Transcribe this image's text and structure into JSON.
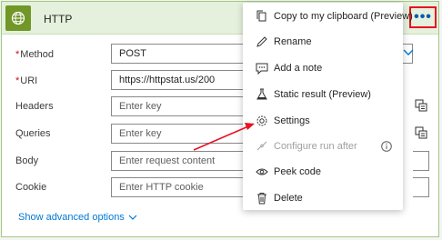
{
  "action": {
    "title": "HTTP"
  },
  "fields": [
    {
      "label": "Method",
      "required": true,
      "value": "POST",
      "placeholder": ""
    },
    {
      "label": "URI",
      "required": true,
      "value": "https://httpstat.us/200",
      "placeholder": ""
    },
    {
      "label": "Headers",
      "required": false,
      "value": "",
      "placeholder": "Enter key"
    },
    {
      "label": "Queries",
      "required": false,
      "value": "",
      "placeholder": "Enter key"
    },
    {
      "label": "Body",
      "required": false,
      "value": "",
      "placeholder": "Enter request content"
    },
    {
      "label": "Cookie",
      "required": false,
      "value": "",
      "placeholder": "Enter HTTP cookie"
    }
  ],
  "required_marker": "*",
  "advanced_options": "Show advanced options",
  "more_button": "•••",
  "menu": {
    "items": [
      {
        "label": "Copy to my clipboard (Preview)",
        "icon": "copy-icon",
        "enabled": true
      },
      {
        "label": "Rename",
        "icon": "pencil-icon",
        "enabled": true
      },
      {
        "label": "Add a note",
        "icon": "note-icon",
        "enabled": true
      },
      {
        "label": "Static result (Preview)",
        "icon": "flask-icon",
        "enabled": true
      },
      {
        "label": "Settings",
        "icon": "gear-icon",
        "enabled": true
      },
      {
        "label": "Configure run after",
        "icon": "link-icon",
        "enabled": false
      },
      {
        "label": "Peek code",
        "icon": "eye-icon",
        "enabled": true
      },
      {
        "label": "Delete",
        "icon": "trash-icon",
        "enabled": true
      }
    ]
  },
  "colors": {
    "header_bg": "#e5f1dc",
    "icon_bg": "#709727",
    "link": "#0078d4",
    "annotation_red": "#e81123"
  }
}
